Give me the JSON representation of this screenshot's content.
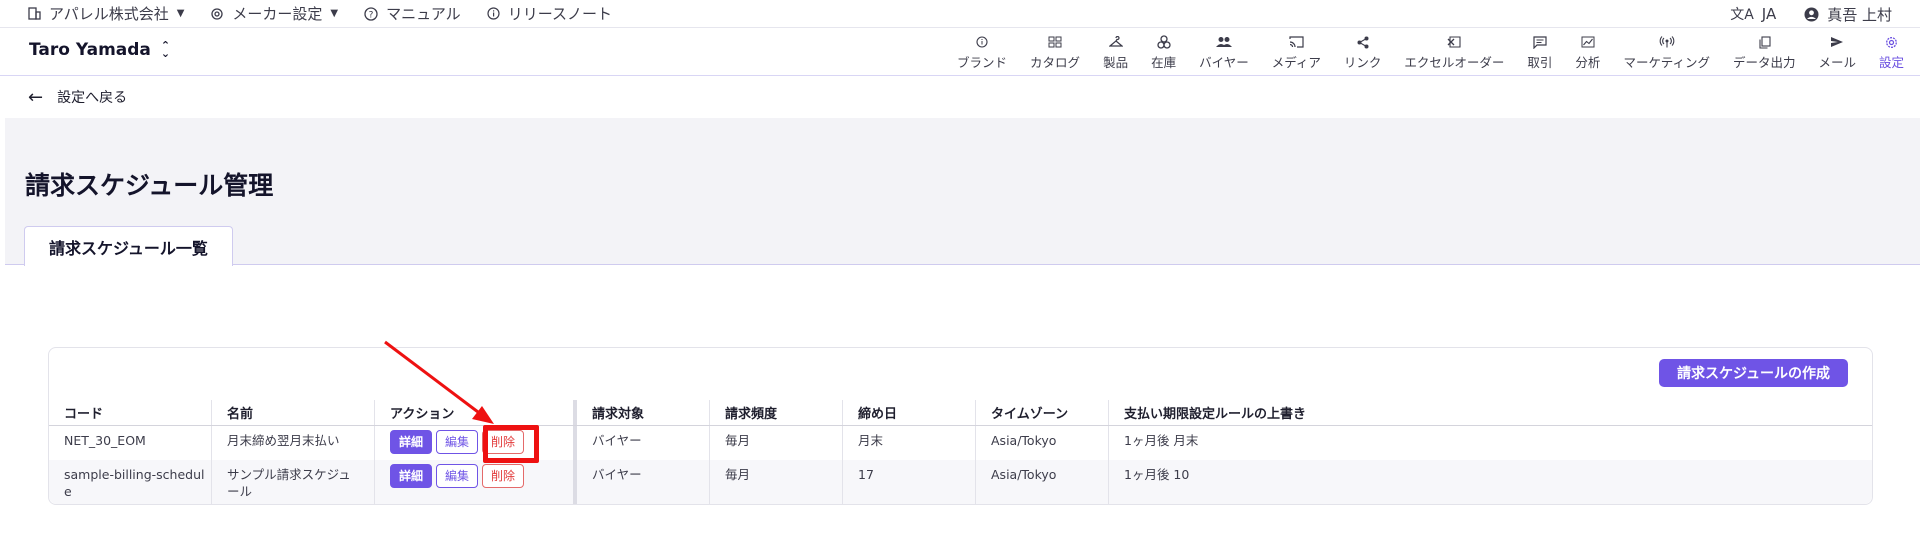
{
  "topbar": {
    "company": "アパレル株式会社",
    "maker_settings": "メーカー設定",
    "manual": "マニュアル",
    "release_notes": "リリースノート",
    "language": "JA",
    "user": "真吾 上村"
  },
  "header": {
    "brand": "Taro Yamada",
    "nav": [
      {
        "label": "ブランド",
        "icon": "info-icon"
      },
      {
        "label": "カタログ",
        "icon": "catalog-icon"
      },
      {
        "label": "製品",
        "icon": "hanger-icon"
      },
      {
        "label": "在庫",
        "icon": "boxes-icon"
      },
      {
        "label": "バイヤー",
        "icon": "people-icon"
      },
      {
        "label": "メディア",
        "icon": "cast-icon"
      },
      {
        "label": "リンク",
        "icon": "share-icon"
      },
      {
        "label": "エクセルオーダー",
        "icon": "excel-icon"
      },
      {
        "label": "取引",
        "icon": "chat-icon"
      },
      {
        "label": "分析",
        "icon": "chart-icon"
      },
      {
        "label": "マーケティング",
        "icon": "broadcast-icon"
      },
      {
        "label": "データ出力",
        "icon": "copy-icon"
      },
      {
        "label": "メール",
        "icon": "send-icon"
      },
      {
        "label": "設定",
        "icon": "gear-icon"
      }
    ]
  },
  "back": {
    "label": "設定へ戻る"
  },
  "page": {
    "title": "請求スケジュール管理",
    "tab": "請求スケジュール一覧",
    "create_button": "請求スケジュールの作成"
  },
  "table": {
    "columns": [
      "コード",
      "名前",
      "アクション",
      "請求対象",
      "請求頻度",
      "締め日",
      "タイムゾーン",
      "支払い期限設定ルールの上書き"
    ],
    "action_labels": {
      "detail": "詳細",
      "edit": "編集",
      "delete": "削除"
    },
    "rows": [
      {
        "code": "NET_30_EOM",
        "name": "月末締め翌月末払い",
        "target": "バイヤー",
        "frequency": "毎月",
        "closing_day": "月末",
        "timezone": "Asia/Tokyo",
        "override": "1ヶ月後 月末"
      },
      {
        "code_l1": "sample-billing-schedul",
        "code_l2": "e",
        "name_l1": "サンプル請求スケジュ",
        "name_l2": "ール",
        "target": "バイヤー",
        "frequency": "毎月",
        "closing_day": "17",
        "timezone": "Asia/Tokyo",
        "override": "1ヶ月後 10"
      }
    ]
  },
  "colors": {
    "accent": "#6f54e6",
    "danger": "#e23a3a",
    "annotation": "#ee1111"
  }
}
